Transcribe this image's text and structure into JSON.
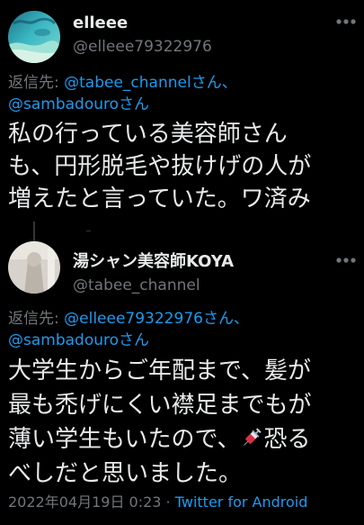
{
  "tweet1": {
    "display_name": "elleee",
    "handle": "@elleee79322976",
    "reply_prefix": "返信先: ",
    "reply_mention_1": "@tabee_channel",
    "reply_san_1": "さん、",
    "reply_mention_2": "@sambadouro",
    "reply_san_2": "さん",
    "text_line_1": "私の行っている美容師さん",
    "text_line_2": "も、円形脱毛や抜けげの人が",
    "text_line_3": "増えたと言っていた。ワ済み"
  },
  "tweet2": {
    "display_name": "湯シャン美容師KOYA",
    "handle": "@tabee_channel",
    "reply_prefix": "返信先: ",
    "reply_mention_1": "@elleee79322976",
    "reply_san_1": "さん、",
    "reply_mention_2": "@sambadouro",
    "reply_san_2": "さん",
    "text_line_1": "大学生からご年配まで、髪が",
    "text_line_2": "最も禿げにくい襟足までもが",
    "text_line_3a": "薄い学生もいたので、",
    "text_line_3b": "恐る",
    "text_line_4": "べしだと思いました。",
    "timestamp": "2022年04月19日 0:23",
    "separator": " · ",
    "source": "Twitter for Android"
  },
  "icons": {
    "more_1": "more-icon",
    "more_2": "more-icon",
    "syringe": "syringe-emoji"
  },
  "colors": {
    "background": "#000000",
    "text": "#e7e9ea",
    "secondary": "#71767b",
    "link": "#1d9bf0"
  }
}
